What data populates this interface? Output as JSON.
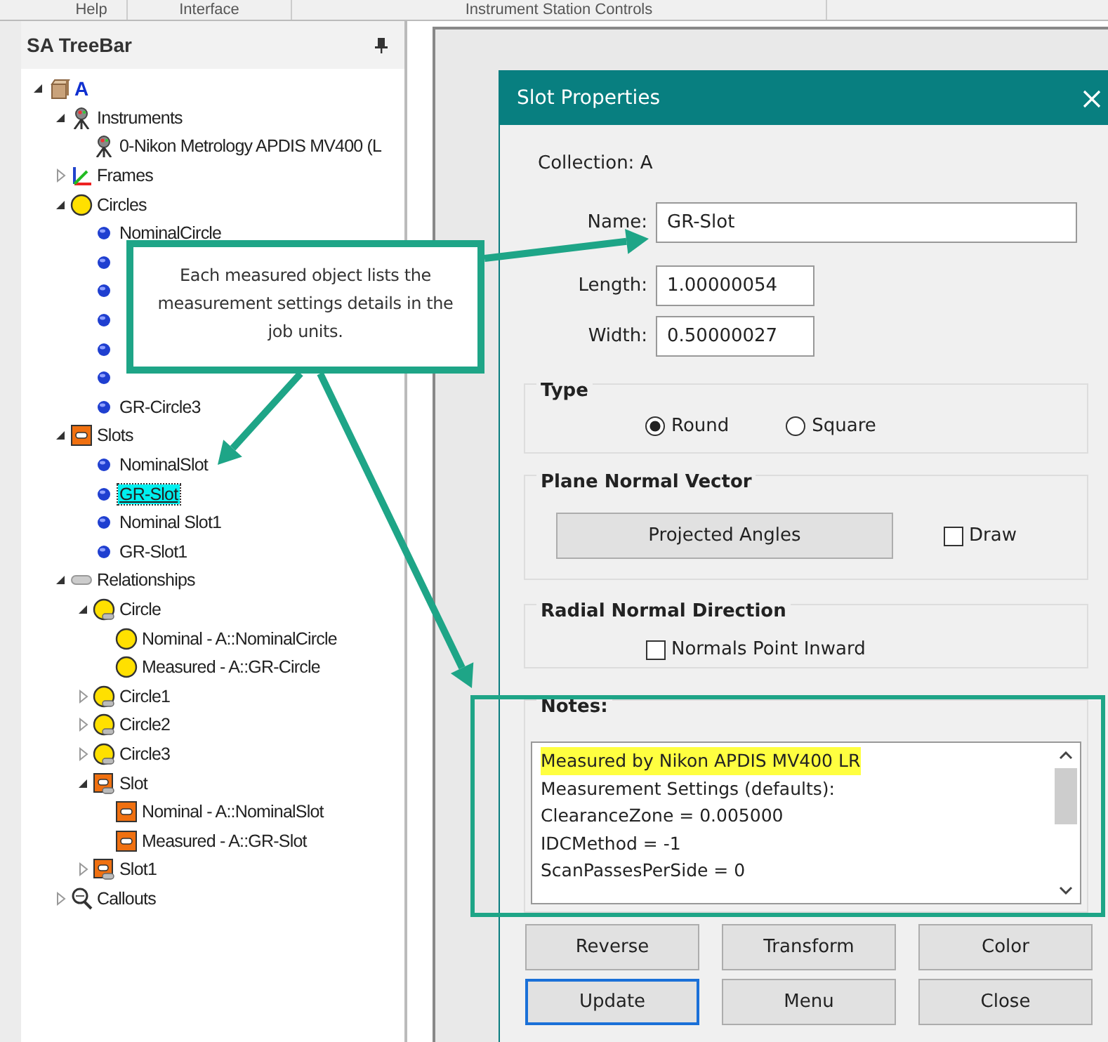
{
  "top_tabs": [
    {
      "label": "Help"
    },
    {
      "label": "Interface"
    },
    {
      "label": "Instrument Station Controls"
    }
  ],
  "treebar": {
    "title": "SA TreeBar"
  },
  "tree": [
    {
      "label": "A",
      "kind": "collection",
      "expanded": true,
      "selected": false,
      "children": [
        {
          "label": "Instruments",
          "kind": "instrument",
          "expanded": true,
          "selected": false,
          "children": [
            {
              "label": "0-Nikon Metrology APDIS MV400 (L",
              "kind": "instrument",
              "selected": false
            }
          ]
        },
        {
          "label": "Frames",
          "kind": "frames",
          "expanded": false,
          "selected": false
        },
        {
          "label": "Circles",
          "kind": "circle-group",
          "expanded": true,
          "selected": false,
          "children": [
            {
              "label": "NominalCircle",
              "kind": "point",
              "selected": false
            },
            {
              "kind": "point",
              "selected": false
            },
            {
              "kind": "point",
              "selected": false
            },
            {
              "kind": "point",
              "selected": false
            },
            {
              "kind": "point",
              "selected": false
            },
            {
              "kind": "point",
              "selected": false
            },
            {
              "label": "GR-Circle3",
              "kind": "point",
              "selected": false
            }
          ]
        },
        {
          "label": "Slots",
          "kind": "slot-group",
          "expanded": true,
          "selected": false,
          "children": [
            {
              "label": "NominalSlot",
              "kind": "point",
              "selected": false
            },
            {
              "label": "GR-Slot",
              "kind": "point",
              "selected": true
            },
            {
              "label": "Nominal Slot1",
              "kind": "point",
              "selected": false
            },
            {
              "label": "GR-Slot1",
              "kind": "point",
              "selected": false
            }
          ]
        },
        {
          "label": "Relationships",
          "kind": "relationship",
          "expanded": true,
          "selected": false,
          "children": [
            {
              "label": "Circle",
              "kind": "circle-rel",
              "expanded": true,
              "selected": false,
              "children": [
                {
                  "label": "Nominal - A::NominalCircle",
                  "kind": "circle",
                  "selected": false
                },
                {
                  "label": "Measured - A::GR-Circle",
                  "kind": "circle",
                  "selected": false
                }
              ]
            },
            {
              "label": "Circle1",
              "kind": "circle-rel",
              "expanded": false,
              "selected": false
            },
            {
              "label": "Circle2",
              "kind": "circle-rel",
              "expanded": false,
              "selected": false
            },
            {
              "label": "Circle3",
              "kind": "circle-rel",
              "expanded": false,
              "selected": false
            },
            {
              "label": "Slot",
              "kind": "slot-rel",
              "expanded": true,
              "selected": false,
              "children": [
                {
                  "label": "Nominal - A::NominalSlot",
                  "kind": "slot",
                  "selected": false
                },
                {
                  "label": "Measured - A::GR-Slot",
                  "kind": "slot",
                  "selected": false
                }
              ]
            },
            {
              "label": "Slot1",
              "kind": "slot-rel",
              "expanded": false,
              "selected": false
            }
          ]
        },
        {
          "label": "Callouts",
          "kind": "callout",
          "expanded": false,
          "selected": false
        }
      ]
    }
  ],
  "dialog": {
    "title": "Slot Properties",
    "collection_label": "Collection:",
    "collection_value": "A",
    "fields": [
      {
        "label": "Name:",
        "value": "GR-Slot"
      },
      {
        "label": "Length:",
        "value": "1.00000054"
      },
      {
        "label": "Width:",
        "value": "0.50000027"
      }
    ],
    "type_group": {
      "title": "Type",
      "options": [
        {
          "label": "Round",
          "selected": true
        },
        {
          "label": "Square",
          "selected": false
        }
      ]
    },
    "plane_group": {
      "title": "Plane Normal Vector",
      "button": "Projected Angles",
      "checkbox": {
        "label": "Draw",
        "checked": false
      }
    },
    "radial_group": {
      "title": "Radial Normal Direction",
      "checkbox": {
        "label": "Normals Point Inward",
        "checked": false
      }
    },
    "notes": {
      "title": "Notes:",
      "lines": [
        {
          "text": "Measured by Nikon APDIS MV400 LR",
          "highlighted": true
        },
        {
          "text": "Measurement Settings (defaults):",
          "highlighted": false
        },
        {
          "text": "ClearanceZone = 0.005000",
          "highlighted": false
        },
        {
          "text": "IDCMethod = -1",
          "highlighted": false
        },
        {
          "text": "ScanPassesPerSide = 0",
          "highlighted": false
        }
      ]
    },
    "buttons": [
      {
        "label": "Reverse",
        "default": false
      },
      {
        "label": "Transform",
        "default": false
      },
      {
        "label": "Color",
        "default": false
      },
      {
        "label": "Update",
        "default": true
      },
      {
        "label": "Menu",
        "default": false
      },
      {
        "label": "Close",
        "default": false
      }
    ]
  },
  "callout": {
    "text": "Each measured object lists the measurement settings details in the job units."
  }
}
